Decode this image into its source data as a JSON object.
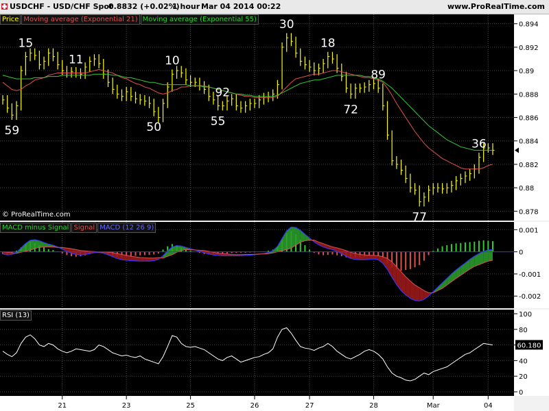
{
  "header": {
    "symbol": "USDCHF - USD/CHF Spot",
    "price": "0.8832 (+0.02%)",
    "timeframe": "1 hour",
    "datetime": "Mar 04 2014 00:22",
    "site": "www.ProRealTime.com"
  },
  "legend": {
    "price": "Price",
    "ema21": "Moving average (Exponential 21)",
    "ema55": "Moving average (Exponential 55)",
    "macd_hist": "MACD minus Signal",
    "macd_signal": "Signal",
    "macd": "MACD (12 26 9)",
    "rsi": "RSI (13)"
  },
  "copyright": "© ProRealTime.com",
  "colors": {
    "price": "#ffff00",
    "ema21": "#e05050",
    "ema55": "#33cc33",
    "macd_hist_pos": "#33cc33",
    "macd_hist_neg": "#e05050",
    "macd": "#3333ff",
    "rsi": "#ffffff"
  },
  "chart_data": [
    {
      "type": "line",
      "panel": "price",
      "x_labels": [
        "21",
        "23",
        "25",
        "26",
        "27",
        "28",
        "Mar",
        "04"
      ],
      "y_ticks": [
        "0.894",
        "0.892",
        "0.89",
        "0.888",
        "0.886",
        "0.884",
        "0.882",
        "0.88",
        "0.878"
      ],
      "ylim": [
        0.8772,
        0.8948
      ],
      "last_value": "0.8832",
      "series": [
        {
          "name": "Price",
          "values": [
            0.8875,
            0.8868,
            0.8862,
            0.887,
            0.89,
            0.8912,
            0.8915,
            0.8913,
            0.8905,
            0.8908,
            0.8915,
            0.8912,
            0.8905,
            0.89,
            0.8898,
            0.8899,
            0.8898,
            0.8897,
            0.8903,
            0.8908,
            0.891,
            0.8906,
            0.8897,
            0.889,
            0.8884,
            0.888,
            0.8878,
            0.8882,
            0.8878,
            0.8876,
            0.8875,
            0.8874,
            0.8872,
            0.8865,
            0.886,
            0.8872,
            0.8886,
            0.8897,
            0.89,
            0.8898,
            0.8892,
            0.889,
            0.889,
            0.8887,
            0.8884,
            0.8878,
            0.8875,
            0.887,
            0.887,
            0.8874,
            0.8876,
            0.887,
            0.8868,
            0.887,
            0.8872,
            0.8872,
            0.8875,
            0.8877,
            0.8878,
            0.888,
            0.8888,
            0.892,
            0.8928,
            0.8925,
            0.8915,
            0.8908,
            0.8905,
            0.8903,
            0.89,
            0.8902,
            0.8906,
            0.8912,
            0.891,
            0.8902,
            0.8895,
            0.8885,
            0.888,
            0.8885,
            0.8885,
            0.8886,
            0.8888,
            0.8889,
            0.8885,
            0.887,
            0.8845,
            0.8823,
            0.882,
            0.8815,
            0.8808,
            0.88,
            0.8798,
            0.8788,
            0.8792,
            0.8798,
            0.88,
            0.88,
            0.8799,
            0.88,
            0.8802,
            0.8806,
            0.8808,
            0.881,
            0.8812,
            0.8816,
            0.8826,
            0.8834,
            0.8834,
            0.8832
          ]
        },
        {
          "name": "Moving average (Exponential 21)",
          "values": [
            0.889,
            0.8887,
            0.8884,
            0.8883,
            0.8884,
            0.8887,
            0.8889,
            0.8892,
            0.8893,
            0.8894,
            0.8896,
            0.8897,
            0.8898,
            0.8898,
            0.8898,
            0.8898,
            0.8898,
            0.8898,
            0.8898,
            0.8899,
            0.89,
            0.8901,
            0.89,
            0.8899,
            0.8898,
            0.8896,
            0.8894,
            0.8893,
            0.8891,
            0.8889,
            0.8888,
            0.8886,
            0.8885,
            0.8883,
            0.8881,
            0.888,
            0.8881,
            0.8883,
            0.8884,
            0.8886,
            0.8886,
            0.8887,
            0.8887,
            0.8887,
            0.8887,
            0.8886,
            0.8885,
            0.8884,
            0.8883,
            0.8882,
            0.8881,
            0.888,
            0.8879,
            0.8878,
            0.8878,
            0.8877,
            0.8877,
            0.8877,
            0.8877,
            0.8877,
            0.8878,
            0.8882,
            0.8886,
            0.889,
            0.8893,
            0.8894,
            0.8895,
            0.8896,
            0.8897,
            0.8897,
            0.8898,
            0.8899,
            0.89,
            0.89,
            0.8899,
            0.8898,
            0.8897,
            0.8896,
            0.8895,
            0.8894,
            0.8894,
            0.8893,
            0.8892,
            0.889,
            0.8885,
            0.8879,
            0.8872,
            0.8866,
            0.886,
            0.8854,
            0.8848,
            0.8843,
            0.8838,
            0.8834,
            0.8831,
            0.8828,
            0.8825,
            0.8823,
            0.8821,
            0.8819,
            0.8817,
            0.8816,
            0.8816,
            0.8816,
            0.8816,
            0.8817,
            0.8819,
            0.882
          ]
        },
        {
          "name": "Moving average (Exponential 55)",
          "values": [
            0.8896,
            0.8895,
            0.8894,
            0.8893,
            0.8893,
            0.8893,
            0.8893,
            0.8894,
            0.8894,
            0.8894,
            0.8895,
            0.8895,
            0.8895,
            0.8896,
            0.8896,
            0.8896,
            0.8896,
            0.8896,
            0.8896,
            0.8896,
            0.8897,
            0.8897,
            0.8897,
            0.8897,
            0.8896,
            0.8896,
            0.8895,
            0.8894,
            0.8894,
            0.8893,
            0.8892,
            0.8891,
            0.889,
            0.889,
            0.8889,
            0.8888,
            0.8888,
            0.8888,
            0.8888,
            0.8888,
            0.8888,
            0.8887,
            0.8887,
            0.8887,
            0.8886,
            0.8886,
            0.8885,
            0.8884,
            0.8883,
            0.8882,
            0.8881,
            0.888,
            0.888,
            0.8879,
            0.8879,
            0.8878,
            0.8878,
            0.8878,
            0.8878,
            0.8878,
            0.8879,
            0.8881,
            0.8883,
            0.8885,
            0.8887,
            0.8889,
            0.889,
            0.8891,
            0.8892,
            0.8892,
            0.8893,
            0.8894,
            0.8895,
            0.8896,
            0.8896,
            0.8896,
            0.8896,
            0.8896,
            0.8896,
            0.8895,
            0.8895,
            0.8894,
            0.8893,
            0.8891,
            0.8888,
            0.8885,
            0.8881,
            0.8877,
            0.8873,
            0.8869,
            0.8865,
            0.8861,
            0.8857,
            0.8853,
            0.885,
            0.8847,
            0.8844,
            0.8841,
            0.8839,
            0.8837,
            0.8835,
            0.8834,
            0.8833,
            0.8832,
            0.8832,
            0.8832,
            0.8832,
            0.8832
          ]
        }
      ],
      "annotations": [
        {
          "text": "59",
          "index": 2
        },
        {
          "text": "15",
          "index": 5
        },
        {
          "text": "11",
          "index": 16
        },
        {
          "text": "50",
          "index": 33
        },
        {
          "text": "10",
          "index": 37
        },
        {
          "text": "55",
          "index": 47
        },
        {
          "text": "92",
          "index": 48
        },
        {
          "text": "30",
          "index": 62
        },
        {
          "text": "18",
          "index": 71
        },
        {
          "text": "72",
          "index": 76
        },
        {
          "text": "89",
          "index": 82
        },
        {
          "text": "77",
          "index": 91
        },
        {
          "text": "36",
          "index": 104
        }
      ]
    },
    {
      "type": "bar",
      "panel": "macd",
      "y_ticks": [
        "0.001",
        "0",
        "-0.001",
        "-0.002"
      ],
      "ylim": [
        -0.00255,
        0.00135
      ],
      "series": [
        {
          "name": "MACD minus Signal",
          "values": [
            -0.0001,
            -0.00012,
            -8e-05,
            5e-05,
            0.0002,
            0.00035,
            0.00045,
            0.0004,
            0.0003,
            0.0002,
            0.00012,
            8e-05,
            2e-05,
            -8e-05,
            -0.00015,
            -0.0002,
            -0.00022,
            -0.0002,
            -0.00016,
            -0.0001,
            -5e-05,
            0.0,
            -5e-05,
            -0.00012,
            -0.00018,
            -0.00022,
            -0.00024,
            -0.00022,
            -0.0002,
            -0.00018,
            -0.00016,
            -0.00015,
            -0.00014,
            -0.00012,
            -8e-05,
            0.0001,
            0.00025,
            0.00035,
            0.0003,
            0.0002,
            0.0001,
            5e-05,
            0.0,
            -5e-05,
            -0.0001,
            -0.00012,
            -0.00012,
            -0.0001,
            -0.0001,
            -8e-05,
            -6e-05,
            -5e-05,
            -4e-05,
            -4e-05,
            -3e-05,
            -2e-05,
            -1e-05,
            2e-05,
            5e-05,
            0.0001,
            0.00025,
            0.00055,
            0.00085,
            0.00095,
            0.0008,
            0.00055,
            0.0003,
            0.0001,
            -5e-05,
            -0.00012,
            -0.00015,
            -0.00014,
            -0.00012,
            -0.00016,
            -0.0002,
            -0.00025,
            -0.00028,
            -0.00026,
            -0.00024,
            -0.00022,
            -0.00018,
            -0.00016,
            -0.00018,
            -0.0003,
            -0.0005,
            -0.0007,
            -0.0008,
            -0.00085,
            -0.00082,
            -0.00078,
            -0.0007,
            -0.0006,
            -0.0004,
            -0.00015,
            5e-05,
            0.00015,
            0.00025,
            0.0003,
            0.00035,
            0.00038,
            0.0004,
            0.00042,
            0.00044,
            0.00046,
            0.0005,
            0.00052,
            0.0005,
            0.00048
          ]
        },
        {
          "name": "MACD (12 26 9)",
          "values": [
            -0.0001,
            -0.00014,
            -0.00012,
            -2e-05,
            0.00018,
            0.00038,
            0.00052,
            0.00055,
            0.0005,
            0.00042,
            0.00035,
            0.0003,
            0.00022,
            0.00012,
            2e-05,
            -6e-05,
            -0.00012,
            -0.00014,
            -0.00012,
            -8e-05,
            -4e-05,
            -2e-05,
            -6e-05,
            -0.00014,
            -0.00022,
            -0.0003,
            -0.00036,
            -0.00038,
            -0.0004,
            -0.00041,
            -0.00042,
            -0.00042,
            -0.00042,
            -0.0004,
            -0.00034,
            -0.00018,
            5e-05,
            0.00022,
            0.00028,
            0.00026,
            0.0002,
            0.00014,
            8e-05,
            2e-05,
            -4e-05,
            -0.0001,
            -0.00014,
            -0.00016,
            -0.00018,
            -0.00018,
            -0.00018,
            -0.00018,
            -0.00017,
            -0.00016,
            -0.00015,
            -0.00013,
            -0.00011,
            -8e-05,
            -3e-05,
            5e-05,
            0.00025,
            0.0006,
            0.00095,
            0.00112,
            0.0011,
            0.00098,
            0.0008,
            0.00062,
            0.00045,
            0.00032,
            0.00022,
            0.00015,
            0.0001,
            2e-05,
            -8e-05,
            -0.0002,
            -0.0003,
            -0.00034,
            -0.00036,
            -0.00036,
            -0.00034,
            -0.00032,
            -0.00036,
            -0.00052,
            -0.0008,
            -0.00115,
            -0.00148,
            -0.00175,
            -0.00195,
            -0.0021,
            -0.0022,
            -0.00222,
            -0.00215,
            -0.002,
            -0.0018,
            -0.0016,
            -0.0014,
            -0.0012,
            -0.001,
            -0.00082,
            -0.00066,
            -0.0005,
            -0.00034,
            -0.0002,
            -8e-05,
            2e-05,
            8e-05,
            0.0001
          ]
        },
        {
          "name": "Signal",
          "values": [
            0.0,
            -2e-05,
            -4e-05,
            -7e-05,
            -2e-05,
            3e-05,
            7e-05,
            0.00015,
            0.0002,
            0.00022,
            0.00023,
            0.00022,
            0.0002,
            0.0002,
            0.00017,
            0.00014,
            0.0001,
            6e-05,
            4e-05,
            2e-05,
            1e-05,
            -2e-05,
            -1e-05,
            -2e-05,
            -4e-05,
            -8e-05,
            -0.00012,
            -0.00016,
            -0.0002,
            -0.00023,
            -0.00026,
            -0.00027,
            -0.00028,
            -0.00028,
            -0.00026,
            -0.00028,
            -0.0002,
            -0.00013,
            -2e-05,
            6e-05,
            0.0001,
            9e-05,
            8e-05,
            7e-05,
            6e-05,
            2e-05,
            -2e-05,
            -6e-05,
            -8e-05,
            -0.0001,
            -0.00012,
            -0.00013,
            -0.00013,
            -0.00012,
            -0.00012,
            -0.00011,
            -0.0001,
            -0.0001,
            -8e-05,
            -5e-05,
            0.0,
            5e-05,
            0.0001,
            0.00017,
            0.0003,
            0.00043,
            0.0005,
            0.00052,
            0.00053,
            0.00044,
            0.00037,
            0.00029,
            0.00022,
            0.00018,
            0.00012,
            5e-05,
            -2e-05,
            -8e-05,
            -0.00012,
            -0.00014,
            -0.00016,
            -0.00016,
            -0.00018,
            -0.00022,
            -0.0003,
            -0.00045,
            -0.00068,
            -0.0009,
            -0.00113,
            -0.00132,
            -0.0015,
            -0.00162,
            -0.00175,
            -0.00185,
            -0.00185,
            -0.00175,
            -0.00165,
            -0.0015,
            -0.00135,
            -0.0012,
            -0.00106,
            -0.00092,
            -0.00078,
            -0.00066,
            -0.00058,
            -0.0005,
            -0.00042,
            -0.00038
          ]
        }
      ]
    },
    {
      "type": "line",
      "panel": "rsi",
      "y_ticks": [
        "100",
        "80",
        "60",
        "40",
        "20",
        "0"
      ],
      "ylim": [
        0,
        100
      ],
      "last_value": "60.180",
      "series": [
        {
          "name": "RSI (13)",
          "values": [
            52,
            48,
            45,
            50,
            62,
            70,
            73,
            68,
            60,
            58,
            62,
            60,
            55,
            52,
            50,
            52,
            55,
            54,
            53,
            52,
            54,
            60,
            58,
            54,
            50,
            48,
            46,
            47,
            45,
            44,
            46,
            42,
            40,
            38,
            36,
            45,
            58,
            72,
            70,
            62,
            58,
            57,
            58,
            56,
            54,
            50,
            46,
            42,
            40,
            44,
            46,
            42,
            38,
            40,
            42,
            44,
            45,
            48,
            50,
            55,
            70,
            80,
            82,
            75,
            66,
            58,
            56,
            55,
            53,
            56,
            58,
            62,
            58,
            52,
            48,
            44,
            42,
            45,
            48,
            52,
            54,
            52,
            48,
            42,
            32,
            24,
            20,
            18,
            15,
            14,
            16,
            20,
            24,
            22,
            26,
            28,
            30,
            32,
            36,
            40,
            44,
            48,
            50,
            54,
            58,
            62,
            61,
            60
          ]
        }
      ]
    }
  ]
}
